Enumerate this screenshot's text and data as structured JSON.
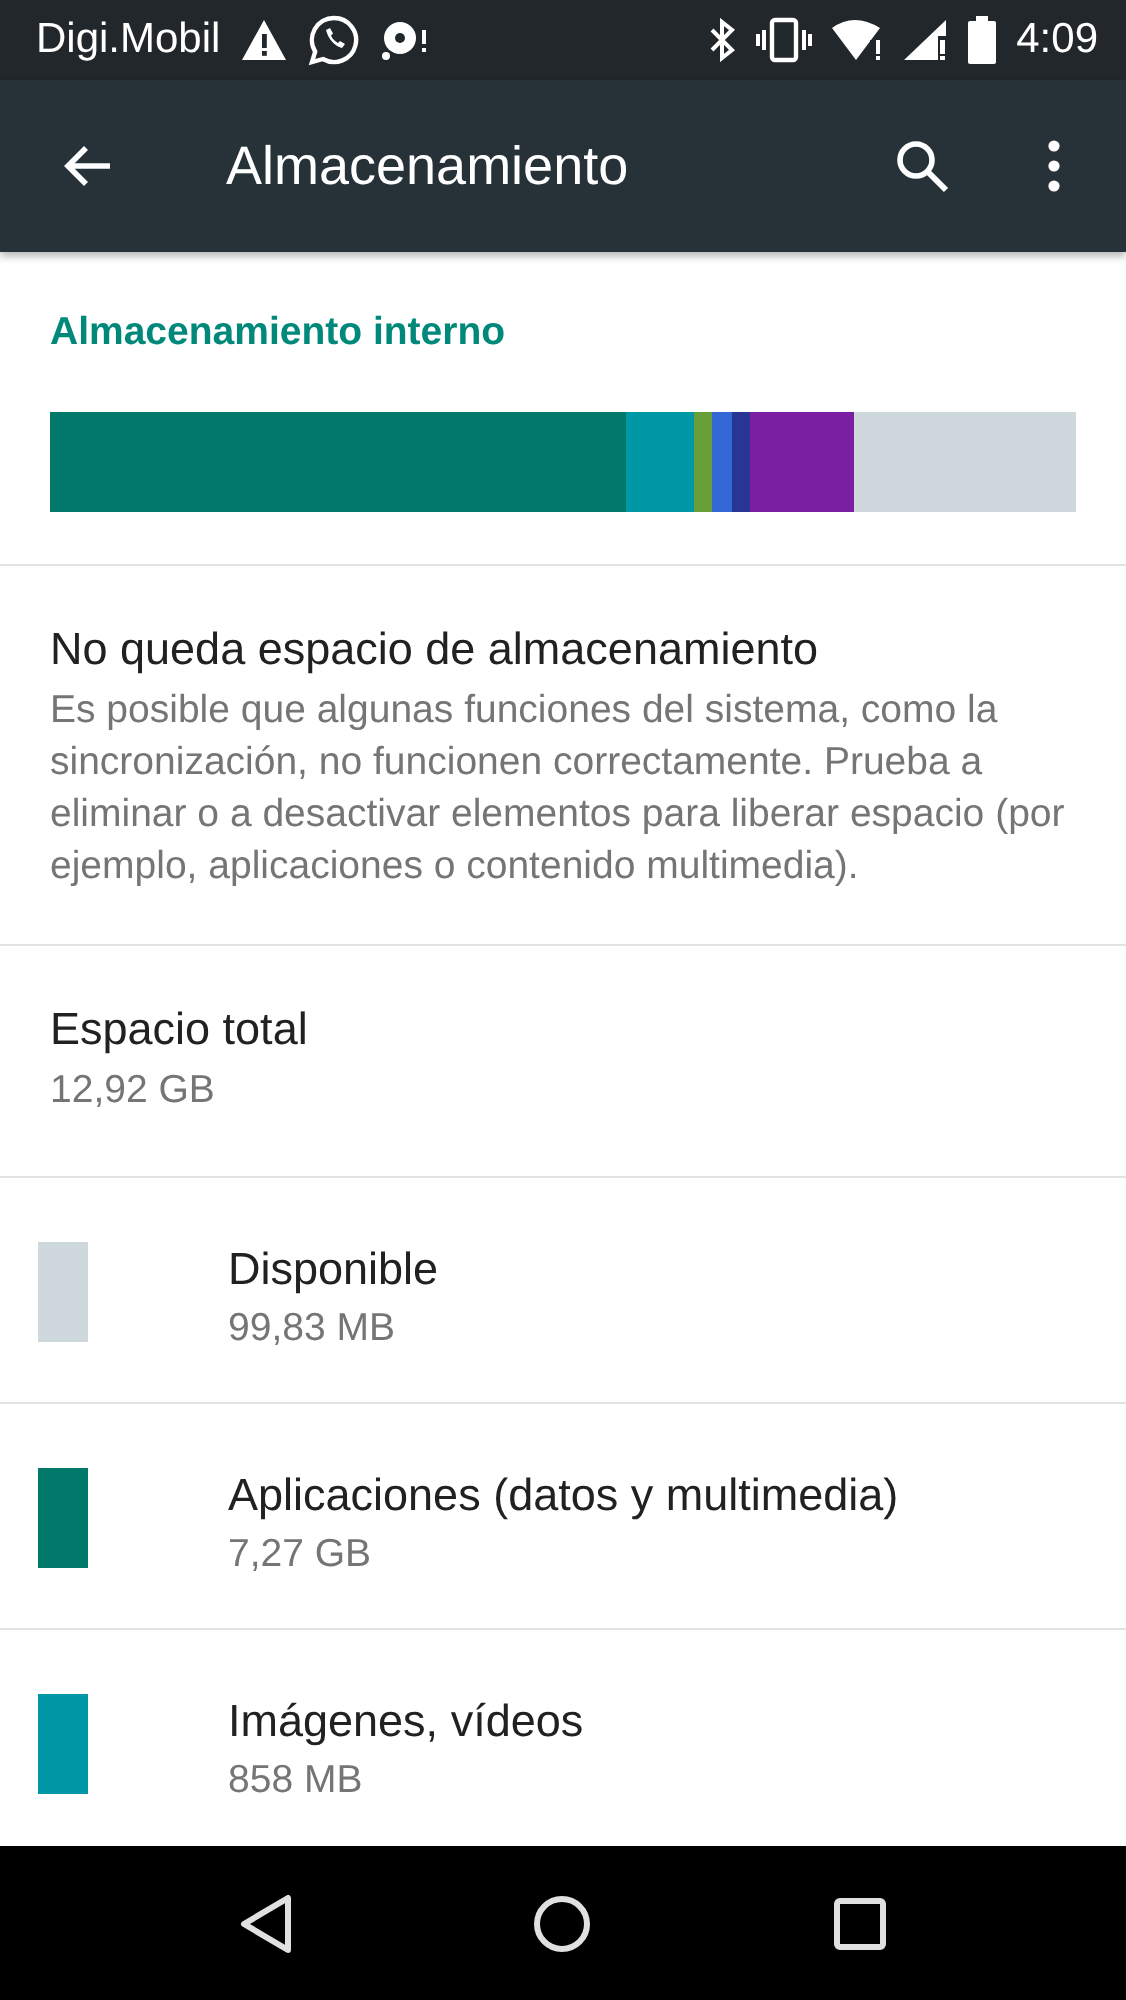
{
  "status_bar": {
    "carrier": "Digi.Mobil",
    "time": "4:09"
  },
  "app_bar": {
    "title": "Almacenamiento"
  },
  "storage": {
    "title": "Almacenamiento interno",
    "segments": [
      {
        "color": "#00796b"
      },
      {
        "color": "#0097a7"
      },
      {
        "color": "#689f38"
      },
      {
        "color": "#3367d6"
      },
      {
        "color": "#283593"
      },
      {
        "color": "#7b1fa2"
      },
      {
        "color": "#cfd8dc"
      }
    ]
  },
  "warning": {
    "title": "No queda espacio de almacenamiento",
    "text": "Es posible que algunas funciones del sistema, como la sincronización, no funcionen correctamente. Prueba a eliminar o a desactivar elementos para liberar espacio (por ejemplo, aplicaciones o contenido multimedia)."
  },
  "total": {
    "label": "Espacio total",
    "value": "12,92 GB"
  },
  "categories": [
    {
      "name": "Disponible",
      "size": "99,83 MB",
      "color": "#cfd8dc"
    },
    {
      "name": "Aplicaciones (datos y multimedia)",
      "size": "7,27 GB",
      "color": "#00796b"
    },
    {
      "name": "Imágenes, vídeos",
      "size": "858 MB",
      "color": "#0097a7"
    }
  ]
}
